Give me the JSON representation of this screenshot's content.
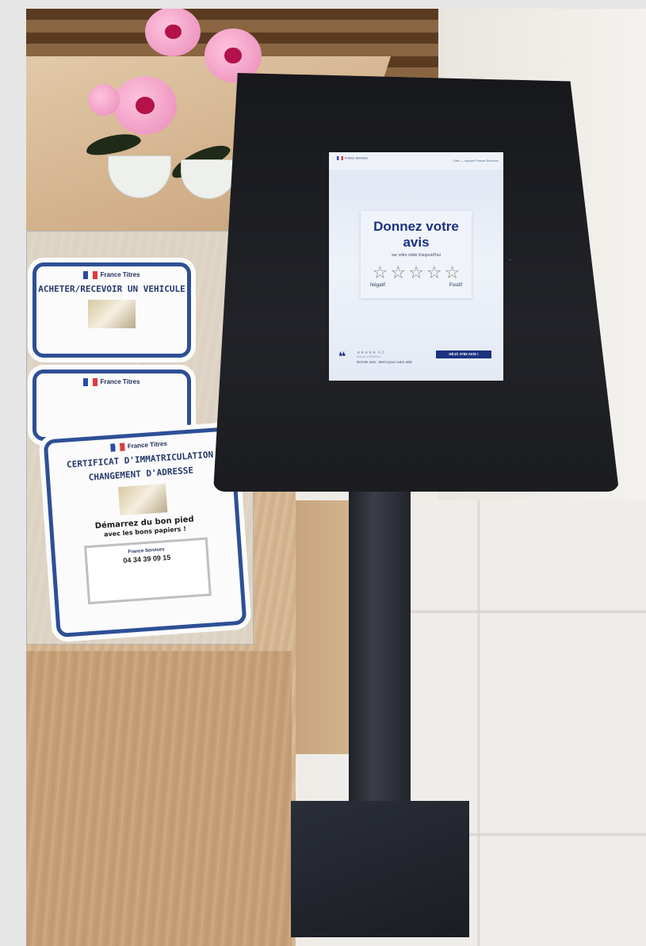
{
  "kiosk": {
    "screen": {
      "header_logo": "France Services",
      "header_right": "Oise — espace France Services",
      "title": "Donnez votre avis",
      "subtitle": "sur votre visite d'aujourd'hui",
      "stars": [
        "☆",
        "☆",
        "☆",
        "☆",
        "☆"
      ],
      "label_negative": "Négatif",
      "label_positive": "Positif",
      "footer_stars": "★★★★★ 4,6",
      "footer_date": "Avis au 17/04/2024",
      "footer_button": "DÉJÀ 3783 AVIS !",
      "footer_text": "Dernier avis : Merci pour votre aide"
    }
  },
  "brochures": {
    "back": {
      "logo": "France Titres",
      "title": "ACHETER/RECEVOIR UN VEHICULE"
    },
    "middle": {
      "logo": "France Titres"
    },
    "front": {
      "logo": "France Titres",
      "title_line1": "CERTIFICAT D'IMMATRICULATION",
      "title_line2": "CHANGEMENT D'ADRESSE",
      "tagline_line1": "Démarrez du bon pied",
      "tagline_line2": "avec les bons papiers !",
      "card_org": "France Services",
      "card_phone": "04 34 39 09 15"
    }
  },
  "colors": {
    "brand_blue": "#1b3280",
    "brochure_border": "#2d4f96",
    "kiosk_frame": "#1b1c20"
  }
}
